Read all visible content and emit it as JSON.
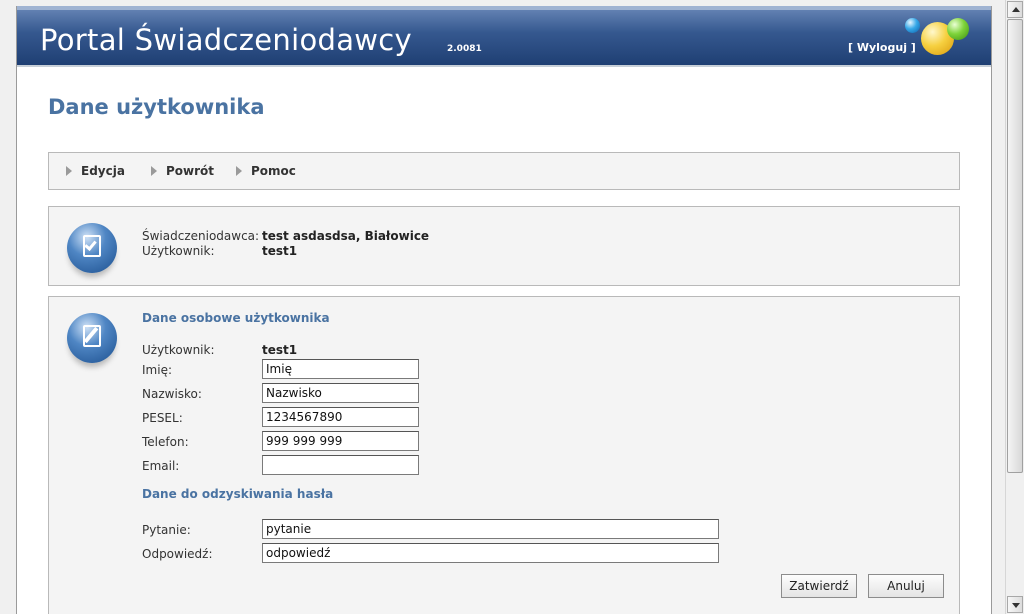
{
  "header": {
    "title": "Portal Świadczeniodawcy",
    "version": "2.0081",
    "logout_label": "[ Wyloguj ]"
  },
  "page_title": "Dane użytkownika",
  "toolbar": {
    "items": [
      {
        "label": "Edycja"
      },
      {
        "label": "Powrót"
      },
      {
        "label": "Pomoc"
      }
    ]
  },
  "info": {
    "provider_label": "Świadczeniodawca:",
    "provider_value": "test asdasdsa, Białowice",
    "user_label": "Użytkownik:",
    "user_value": "test1"
  },
  "personal": {
    "section_title": "Dane osobowe użytkownika",
    "user_label": "Użytkownik:",
    "user_value": "test1",
    "first_name_label": "Imię:",
    "first_name_value": "Imię",
    "last_name_label": "Nazwisko:",
    "last_name_value": "Nazwisko",
    "pesel_label": "PESEL:",
    "pesel_value": "1234567890",
    "phone_label": "Telefon:",
    "phone_value": "999 999 999",
    "email_label": "Email:",
    "email_value": ""
  },
  "recovery": {
    "section_title": "Dane do odzyskiwania hasła",
    "question_label": "Pytanie:",
    "question_value": "pytanie",
    "answer_label": "Odpowiedź:",
    "answer_value": "odpowiedź"
  },
  "buttons": {
    "submit_label": "Zatwierdź",
    "cancel_label": "Anuluj"
  },
  "colors": {
    "accent": "#4a73a2",
    "header_dark": "#1f3f73",
    "panel_bg": "#f4f4f4"
  }
}
